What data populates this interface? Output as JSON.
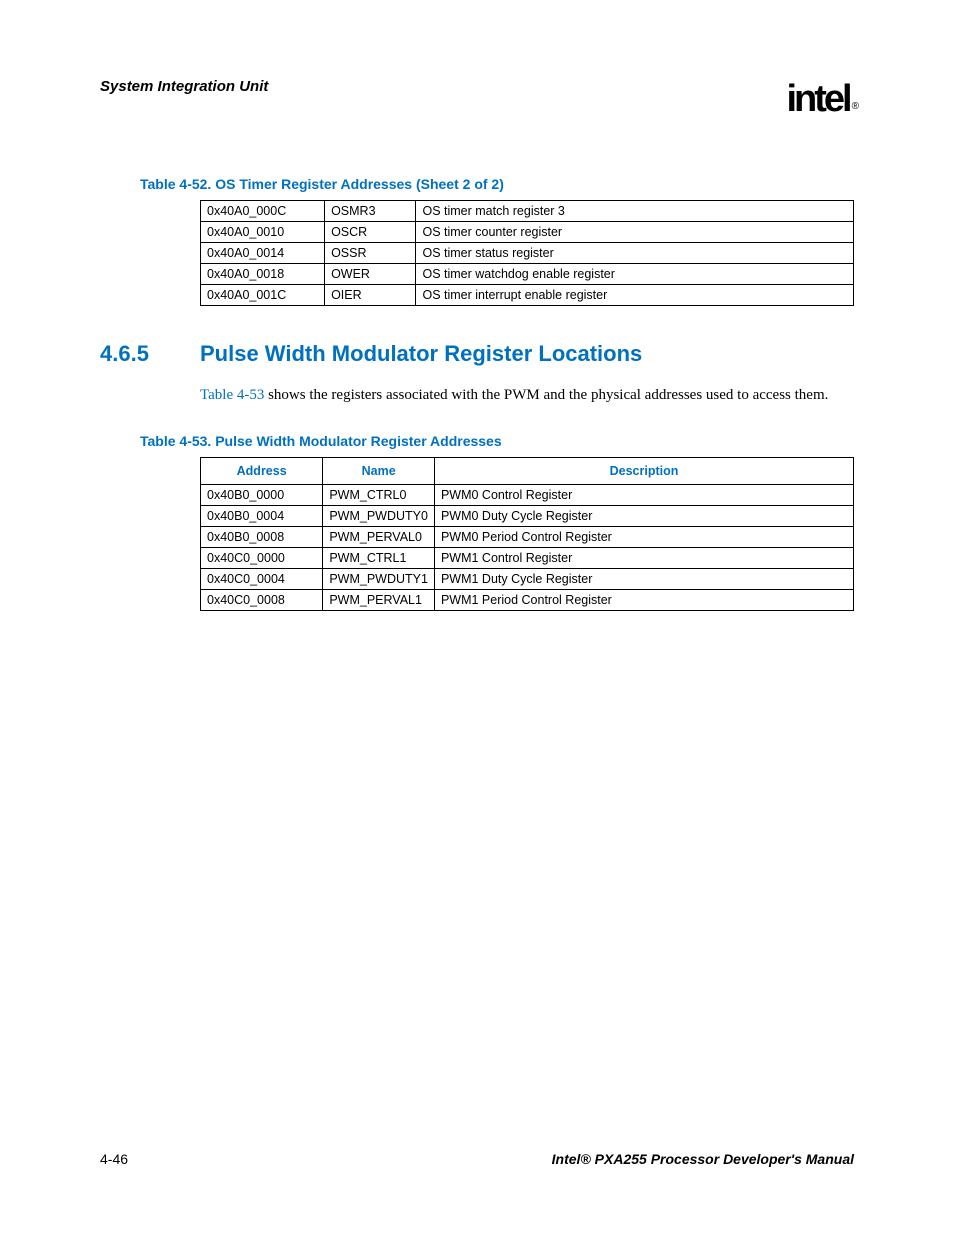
{
  "header": {
    "title": "System Integration Unit",
    "logo": "intel",
    "logo_reg": "®"
  },
  "table52": {
    "caption": "Table 4-52. OS Timer Register Addresses (Sheet 2 of 2)",
    "rows": [
      {
        "address": "0x40A0_000C",
        "name": "OSMR3",
        "desc": "OS timer match register 3"
      },
      {
        "address": "0x40A0_0010",
        "name": "OSCR",
        "desc": "OS timer counter register"
      },
      {
        "address": "0x40A0_0014",
        "name": "OSSR",
        "desc": "OS timer status register"
      },
      {
        "address": "0x40A0_0018",
        "name": "OWER",
        "desc": "OS timer watchdog enable register"
      },
      {
        "address": "0x40A0_001C",
        "name": "OIER",
        "desc": "OS timer interrupt enable register"
      }
    ]
  },
  "section": {
    "number": "4.6.5",
    "title": "Pulse Width Modulator Register Locations",
    "body_link": "Table 4-53",
    "body_rest": " shows the registers associated with the PWM and the physical addresses used to access them."
  },
  "table53": {
    "caption": "Table 4-53. Pulse Width Modulator Register Addresses",
    "headers": {
      "address": "Address",
      "name": "Name",
      "desc": "Description"
    },
    "rows": [
      {
        "address": "0x40B0_0000",
        "name": "PWM_CTRL0",
        "desc": "PWM0 Control Register"
      },
      {
        "address": "0x40B0_0004",
        "name": "PWM_PWDUTY0",
        "desc": "PWM0 Duty Cycle Register"
      },
      {
        "address": "0x40B0_0008",
        "name": "PWM_PERVAL0",
        "desc": "PWM0 Period Control Register"
      },
      {
        "address": "0x40C0_0000",
        "name": "PWM_CTRL1",
        "desc": "PWM1 Control Register"
      },
      {
        "address": "0x40C0_0004",
        "name": "PWM_PWDUTY1",
        "desc": "PWM1 Duty Cycle Register"
      },
      {
        "address": "0x40C0_0008",
        "name": "PWM_PERVAL1",
        "desc": "PWM1 Period Control Register"
      }
    ]
  },
  "footer": {
    "page": "4-46",
    "manual": "Intel® PXA255 Processor Developer's Manual"
  }
}
